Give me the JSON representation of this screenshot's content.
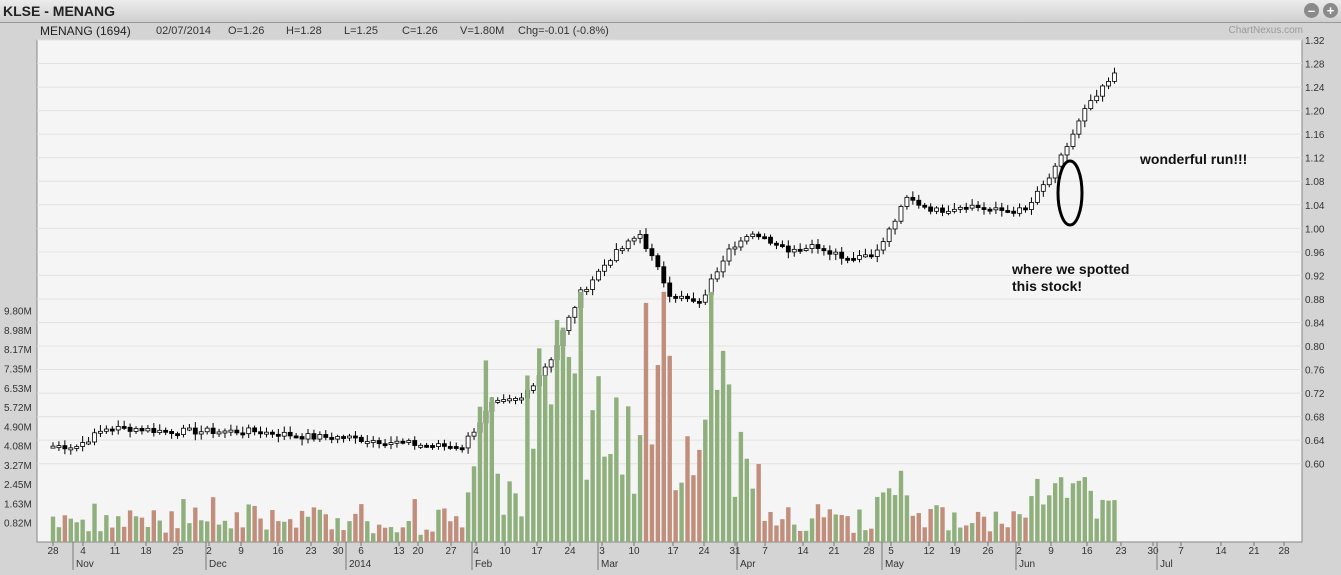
{
  "window": {
    "title": "KLSE - MENANG",
    "minimize_icon": "minus-circle-icon",
    "maximize_icon": "plus-circle-icon"
  },
  "info": {
    "symbol": "MENANG (1694)",
    "date": "02/07/2014",
    "open": "O=1.26",
    "high": "H=1.28",
    "low": "L=1.25",
    "close": "C=1.26",
    "volume": "V=1.80M",
    "change": "Chg=-0.01 (-0.8%)",
    "brand": "ChartNexus.com"
  },
  "annotations": {
    "spotted_line1": "where we spotted",
    "spotted_line2": "this stock!",
    "run": "wonderful run!!!"
  },
  "colors": {
    "up_volume": "#8fb07d",
    "down_volume": "#c28e7c",
    "plot_bg": "#f5f5f5",
    "grid": "#e2e2e2"
  },
  "chart_data": {
    "type": "candlestick",
    "price_axis_ticks": [
      "1.32",
      "1.28",
      "1.24",
      "1.20",
      "1.16",
      "1.12",
      "1.08",
      "1.04",
      "1.00",
      "0.96",
      "0.92",
      "0.88",
      "0.84",
      "0.80",
      "0.76",
      "0.72",
      "0.68",
      "0.64",
      "0.60"
    ],
    "volume_axis_ticks": [
      "9.80M",
      "8.98M",
      "8.17M",
      "7.35M",
      "6.53M",
      "5.72M",
      "4.90M",
      "4.08M",
      "3.27M",
      "2.45M",
      "1.63M",
      "0.82M"
    ],
    "day_ticks": [
      "28",
      "4",
      "11",
      "18",
      "25",
      "2",
      "9",
      "16",
      "23",
      "30",
      "6",
      "13",
      "20",
      "27",
      "4",
      "10",
      "17",
      "24",
      "3",
      "10",
      "17",
      "24",
      "31",
      "7",
      "14",
      "21",
      "28",
      "5",
      "12",
      "19",
      "26",
      "2",
      "9",
      "16",
      "23",
      "30",
      "7",
      "14",
      "21",
      "28"
    ],
    "month_labels": [
      "Nov",
      "Dec",
      "2014",
      "Feb",
      "Mar",
      "Apr",
      "May",
      "Jun",
      "Jul"
    ],
    "close_path_weekly": [
      {
        "date": "2013-10-28",
        "close": 0.63
      },
      {
        "date": "2013-11-04",
        "close": 0.66
      },
      {
        "date": "2013-11-11",
        "close": 0.66
      },
      {
        "date": "2013-11-18",
        "close": 0.655
      },
      {
        "date": "2013-11-25",
        "close": 0.655
      },
      {
        "date": "2013-12-02",
        "close": 0.655
      },
      {
        "date": "2013-12-09",
        "close": 0.655
      },
      {
        "date": "2013-12-16",
        "close": 0.65
      },
      {
        "date": "2013-12-23",
        "close": 0.645
      },
      {
        "date": "2013-12-30",
        "close": 0.645
      },
      {
        "date": "2014-01-06",
        "close": 0.64
      },
      {
        "date": "2014-01-13",
        "close": 0.635
      },
      {
        "date": "2014-01-20",
        "close": 0.63
      },
      {
        "date": "2014-01-27",
        "close": 0.63
      },
      {
        "date": "2014-02-03",
        "close": 0.7
      },
      {
        "date": "2014-02-10",
        "close": 0.71
      },
      {
        "date": "2014-02-17",
        "close": 0.78
      },
      {
        "date": "2014-02-24",
        "close": 0.89
      },
      {
        "date": "2014-03-03",
        "close": 0.95
      },
      {
        "date": "2014-03-10",
        "close": 0.99
      },
      {
        "date": "2014-03-17",
        "close": 0.89
      },
      {
        "date": "2014-03-24",
        "close": 0.87
      },
      {
        "date": "2014-03-31",
        "close": 0.97
      },
      {
        "date": "2014-04-07",
        "close": 0.99
      },
      {
        "date": "2014-04-14",
        "close": 0.965
      },
      {
        "date": "2014-04-21",
        "close": 0.97
      },
      {
        "date": "2014-04-28",
        "close": 0.95
      },
      {
        "date": "2014-05-05",
        "close": 0.96
      },
      {
        "date": "2014-05-12",
        "close": 1.05
      },
      {
        "date": "2014-05-19",
        "close": 1.03
      },
      {
        "date": "2014-05-26",
        "close": 1.04
      },
      {
        "date": "2014-06-02",
        "close": 1.03
      },
      {
        "date": "2014-06-09",
        "close": 1.03
      },
      {
        "date": "2014-06-16",
        "close": 1.1
      },
      {
        "date": "2014-06-23",
        "close": 1.2
      },
      {
        "date": "2014-06-30",
        "close": 1.26
      }
    ],
    "last_bar": {
      "date": "2014-07-02",
      "open": 1.26,
      "high": 1.28,
      "low": 1.25,
      "close": 1.26,
      "volume": "1.80M"
    }
  }
}
